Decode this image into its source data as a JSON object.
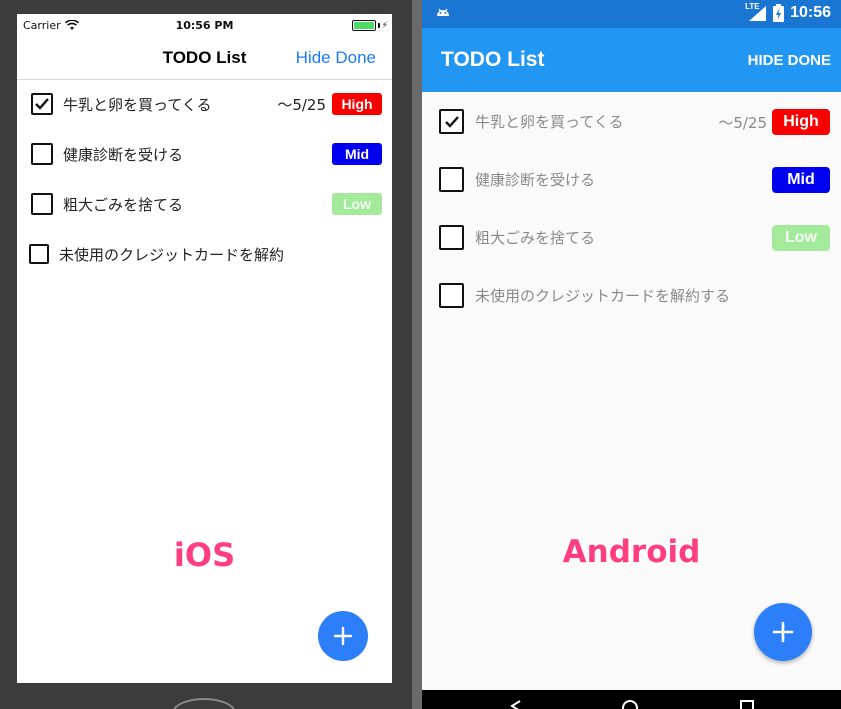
{
  "ios": {
    "status": {
      "carrier": "Carrier",
      "time": "10:56 PM",
      "battery_level": 1.0
    },
    "nav": {
      "title": "TODO List",
      "hide_done": "Hide Done"
    },
    "todos": [
      {
        "label": "牛乳と卵を買ってくる",
        "checked": true,
        "due": "〜5/25",
        "priority": "High"
      },
      {
        "label": "健康診断を受ける",
        "checked": false,
        "due": "",
        "priority": "Mid"
      },
      {
        "label": "粗大ごみを捨てる",
        "checked": false,
        "due": "",
        "priority": "Low"
      },
      {
        "label": "未使用のクレジットカードを解約",
        "checked": false,
        "due": "",
        "priority": ""
      }
    ],
    "caption": "iOS",
    "fab_icon": "plus-icon"
  },
  "android": {
    "status": {
      "time": "10:56",
      "network": "LTE"
    },
    "appbar": {
      "title": "TODO List",
      "hide_done": "HIDE DONE"
    },
    "todos": [
      {
        "label": "牛乳と卵を買ってくる",
        "checked": true,
        "due": "〜5/25",
        "priority": "High"
      },
      {
        "label": "健康診断を受ける",
        "checked": false,
        "due": "",
        "priority": "Mid"
      },
      {
        "label": "粗大ごみを捨てる",
        "checked": false,
        "due": "",
        "priority": "Low"
      },
      {
        "label": "未使用のクレジットカードを解約する",
        "checked": false,
        "due": "",
        "priority": ""
      }
    ],
    "caption": "Android",
    "fab_icon": "plus-icon"
  },
  "colors": {
    "priority_high": "#f80000",
    "priority_mid": "#0000f0",
    "priority_low": "#a3ea9b",
    "ios_accent": "#1a7cf5",
    "android_primary": "#2196f3",
    "android_status": "#1976d2",
    "fab": "#2d7ff9",
    "caption": "#ff3d7f"
  }
}
